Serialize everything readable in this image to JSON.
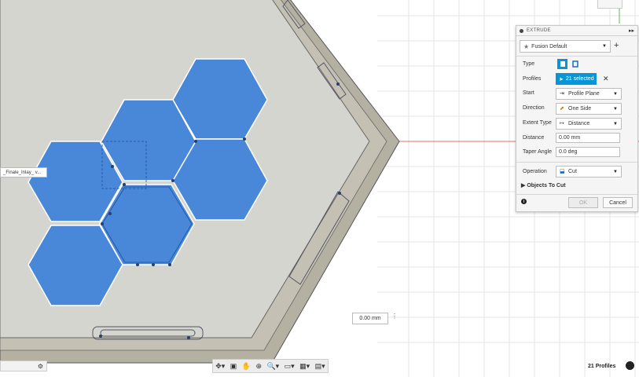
{
  "panel": {
    "title": "EXTRUDE",
    "preset": "Fusion Default",
    "type_label": "Type",
    "profiles_label": "Profiles",
    "profiles_value": "21 selected",
    "start_label": "Start",
    "start_value": "Profile Plane",
    "direction_label": "Direction",
    "direction_value": "One Side",
    "extent_label": "Extent Type",
    "extent_value": "Distance",
    "distance_label": "Distance",
    "distance_value": "0.00 mm",
    "taper_label": "Taper Angle",
    "taper_value": "0.0 deg",
    "operation_label": "Operation",
    "operation_value": "Cut",
    "objects_to_cut": "Objects To Cut",
    "ok": "OK",
    "cancel": "Cancel"
  },
  "viewport": {
    "tooltip": "_Finale_Inlay_ v...",
    "dimension_value": "0.00 mm",
    "status": "21 Profiles"
  },
  "colors": {
    "accent": "#0696d7",
    "selected_profile": "#3a7fd9",
    "frame": "#b5b1a2",
    "floor": "#d5d5cf"
  }
}
